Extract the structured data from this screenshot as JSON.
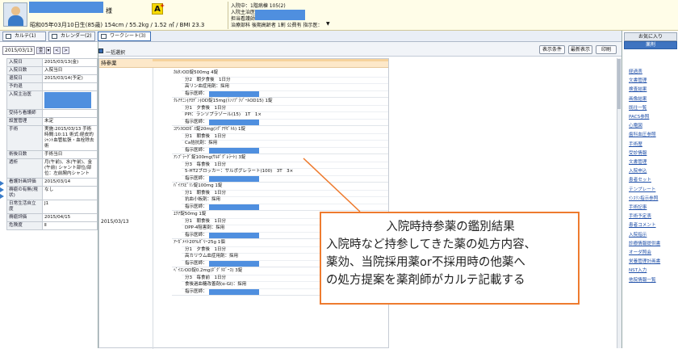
{
  "patient": {
    "sama": "様",
    "birthline": "昭和05年03月10日生(85歳) 154cm / 55.2kg / 1.52 ㎡ / BMI 23.3",
    "badge": "A"
  },
  "header_info": [
    "入院中：1階病棟 105(2)",
    "入院主治医",
    "担当看護師",
    "治療部科 後期高齢者 1割 公費有 指示医："
  ],
  "tabs": [
    "カルテ(1)",
    "カレンダー(2)",
    "ワークシート(3)"
  ],
  "left": {
    "date": "2015/03/13",
    "weekday": "金",
    "select_all": "一括選択",
    "rows": [
      {
        "k": "入院日",
        "v": "2015/03/13(金)"
      },
      {
        "k": "入院日数",
        "v": "入院当日"
      },
      {
        "k": "退院日",
        "v": "2015/03/14(予定)"
      },
      {
        "k": "予約退",
        "v": ""
      },
      {
        "k": "入院主治医",
        "v": ""
      },
      {
        "k": "受持ち看護師",
        "v": ""
      },
      {
        "k": "設置管理",
        "v": "未定"
      },
      {
        "k": "手術",
        "v": "実施:2015/03/13 手術時間:10:11 術式:経皮的ｼｬﾝﾄ血管拡張・血栓除去術"
      },
      {
        "k": "術後日数",
        "v": "手術当日"
      },
      {
        "k": "透析",
        "v": "月(午前)、水(午前)、金(午前) シャント部位/部位：左前腕内シャント"
      },
      {
        "k": "看護計画評価",
        "v": "2015/03/14"
      },
      {
        "k": "褥瘡の有無(現状)",
        "v": "なし"
      },
      {
        "k": "日常生活自立度",
        "v": "J1"
      },
      {
        "k": "褥瘡評価",
        "v": "2015/04/15"
      },
      {
        "k": "危険度",
        "v": "Ⅱ"
      }
    ]
  },
  "main": {
    "buttons": [
      "表示条件",
      "最新表示",
      "印刷"
    ],
    "section": "持参薬",
    "date": "2015/03/13",
    "drugs": [
      {
        "name": "ｶﾙﾀﾝOD錠500mg 4錠",
        "lines": [
          "分2　朝夕食後　1日分",
          "高リン血症用剤：採用"
        ]
      },
      {
        "name": "ｸﾚｱﾁﾆﾝ(ｱﾛﾁﾞﾝ)OD錠15mg(ﾗﾝｿﾌﾟﾗｿﾞｰﾙOD15) 1錠",
        "lines": [
          "分1　夕食後　1日分",
          "PPI：ランソプラゾール(15)　1T　1×"
        ]
      },
      {
        "name": "ｺｱｼｽODｶﾞｽ錠20mg(ｼｸﾞｱﾁｾﾞﾄﾙ) 1錠",
        "lines": [
          "分1　朝食後　1日分",
          "Ca拮抗剤：採用"
        ]
      },
      {
        "name": "ｱﾝﾌﾟﾗｰｸﾞ錠100mg(ｻﾙﾎﾟｸﾞﾚﾗｰﾄ) 3錠",
        "lines": [
          "分3　毎食後　1日分",
          "5-HT2ブロッカー：サルポグレラート(100)　3T　3×"
        ]
      },
      {
        "name": "ﾊﾞｲｱｽﾋﾟﾘﾝ錠100mg 1錠",
        "lines": [
          "分1　朝食後　1日分",
          "抗血小板剤：採用"
        ]
      },
      {
        "name": "ｴｸｱ錠50mg 1錠",
        "lines": [
          "分1　朝食後　1日分",
          "DPP-4阻害剤：採用"
        ]
      },
      {
        "name": "ｱｰｶﾞﾒｲﾄ20%ｾﾞﾘｰ25g 1個",
        "lines": [
          "分1　夕食後　1日分",
          "高カリウム血症用剤：採用"
        ]
      },
      {
        "name": "ﾍﾞｲｽﾝOD錠0.2mg(ﾎﾞｸﾞﾘﾎﾞｰｽ) 3錠",
        "lines": [
          "分3　毎食前　1日分",
          "食後過血糖改善剤(α-GI)：採用"
        ]
      }
    ],
    "doctor_label": "指示医師："
  },
  "callout": {
    "title": "入院時持参薬の鑑別結果",
    "lines": [
      "入院時など持参してきた薬の処方内容、",
      "薬効、当院採用薬or不採用時の他薬へ",
      "の処方提案を薬剤師がカルテ記載する"
    ]
  },
  "right": {
    "tabs": [
      "お気に入り",
      "薬剤"
    ],
    "links": [
      "経過表",
      "文書管理",
      "検査結果",
      "画像結果",
      "既往一覧",
      "PACS参照",
      "心電図",
      "歯科血圧参照",
      "手術歴",
      "受診情報",
      "文書管理",
      "入院申込",
      "患者セット",
      "テンプレート",
      "ｲﾝｽﾘﾝ指示参照",
      "手術記事",
      "手術予定表",
      "患者コメント",
      "入院指示",
      "診療情報提供書",
      "オーダ照会",
      "栄養管理計画書",
      "NST入力",
      "他院情報一覧"
    ]
  },
  "colors": {
    "accent": "#4f8fdf",
    "callout_border": "#ee7b2f",
    "section_bg": "#fde8c9"
  }
}
